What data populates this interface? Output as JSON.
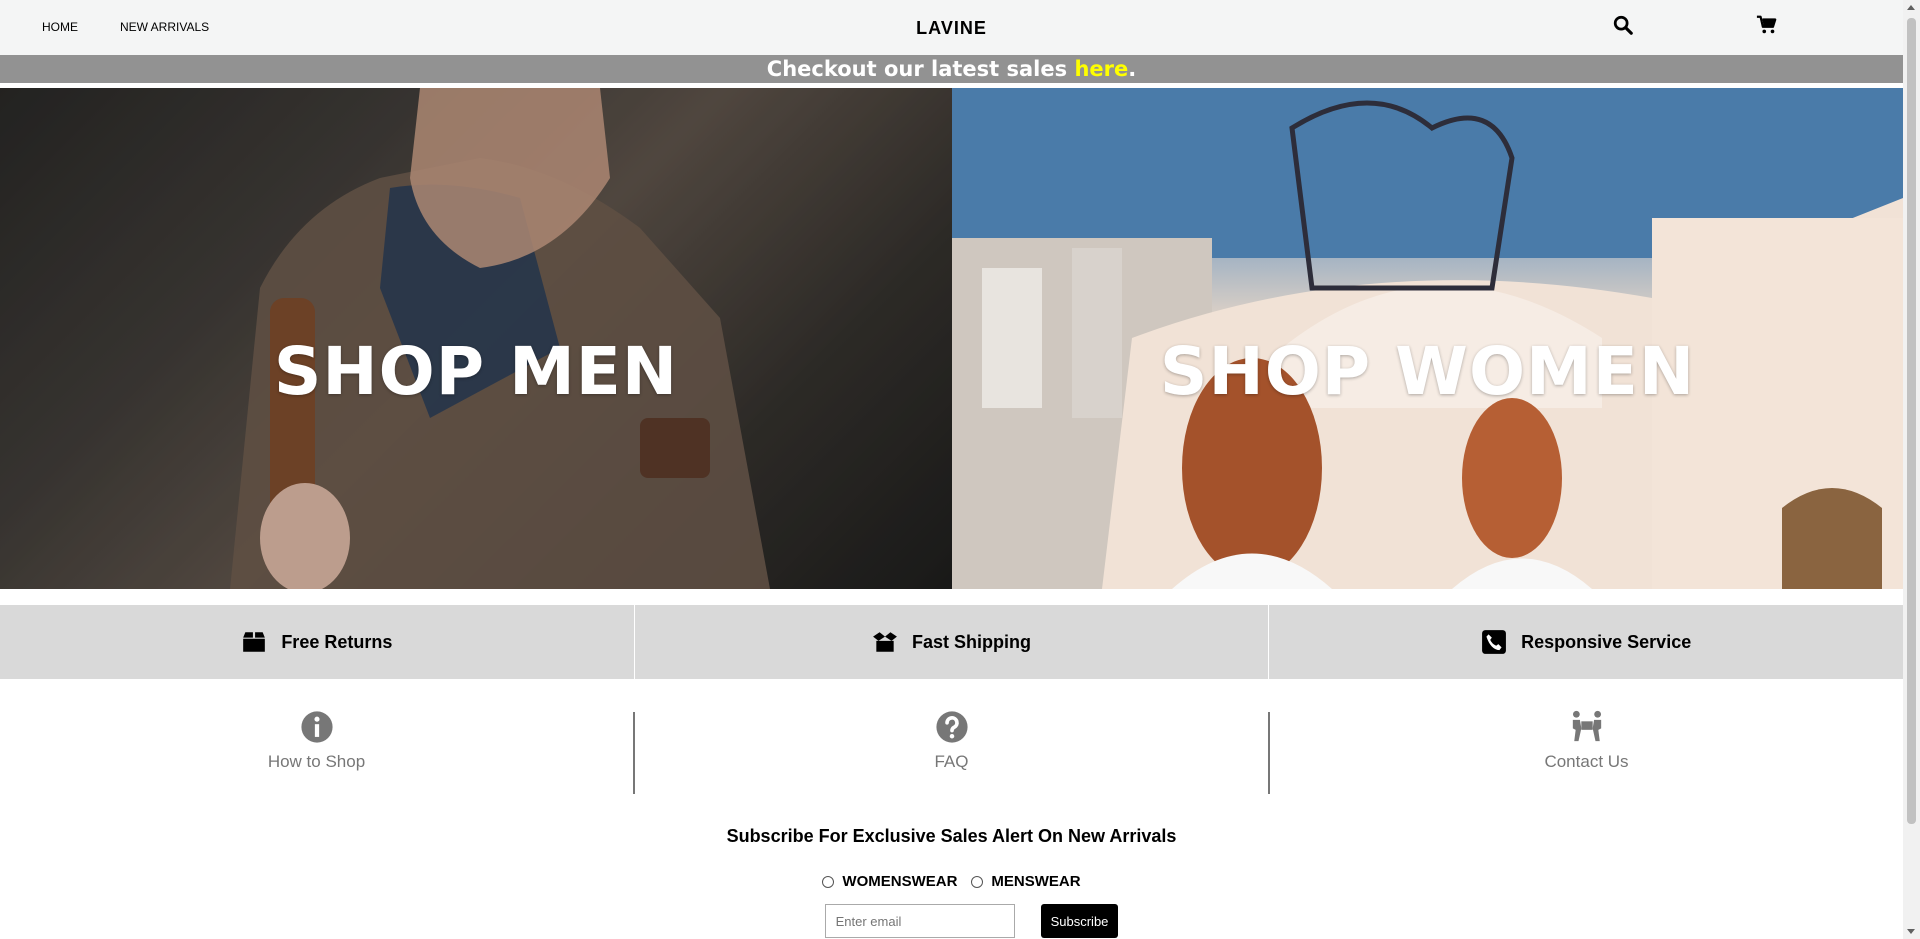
{
  "nav": {
    "links": [
      {
        "label": "HOME"
      },
      {
        "label": "NEW ARRIVALS"
      }
    ],
    "brand": "LAVINE",
    "icons": {
      "search": "search-icon",
      "cart": "cart-icon"
    }
  },
  "promo": {
    "text_before": "Checkout our latest sales ",
    "link_text": "here",
    "text_after": ".",
    "link_color": "#ffff00"
  },
  "hero": {
    "men_label": "SHOP MEN",
    "women_label": "SHOP WOMEN"
  },
  "features": [
    {
      "icon": "box-icon",
      "label": "Free Returns"
    },
    {
      "icon": "open-box-icon",
      "label": "Fast Shipping"
    },
    {
      "icon": "phone-icon",
      "label": "Responsive Service"
    }
  ],
  "help": [
    {
      "icon": "info-icon",
      "label": "How to Shop"
    },
    {
      "icon": "question-icon",
      "label": "FAQ"
    },
    {
      "icon": "people-carry-icon",
      "label": "Contact Us"
    }
  ],
  "subscribe": {
    "heading": "Subscribe For Exclusive Sales Alert On New Arrivals",
    "options": [
      "WOMENSWEAR",
      "MENSWEAR"
    ],
    "email_placeholder": "Enter email",
    "button_label": "Subscribe"
  }
}
